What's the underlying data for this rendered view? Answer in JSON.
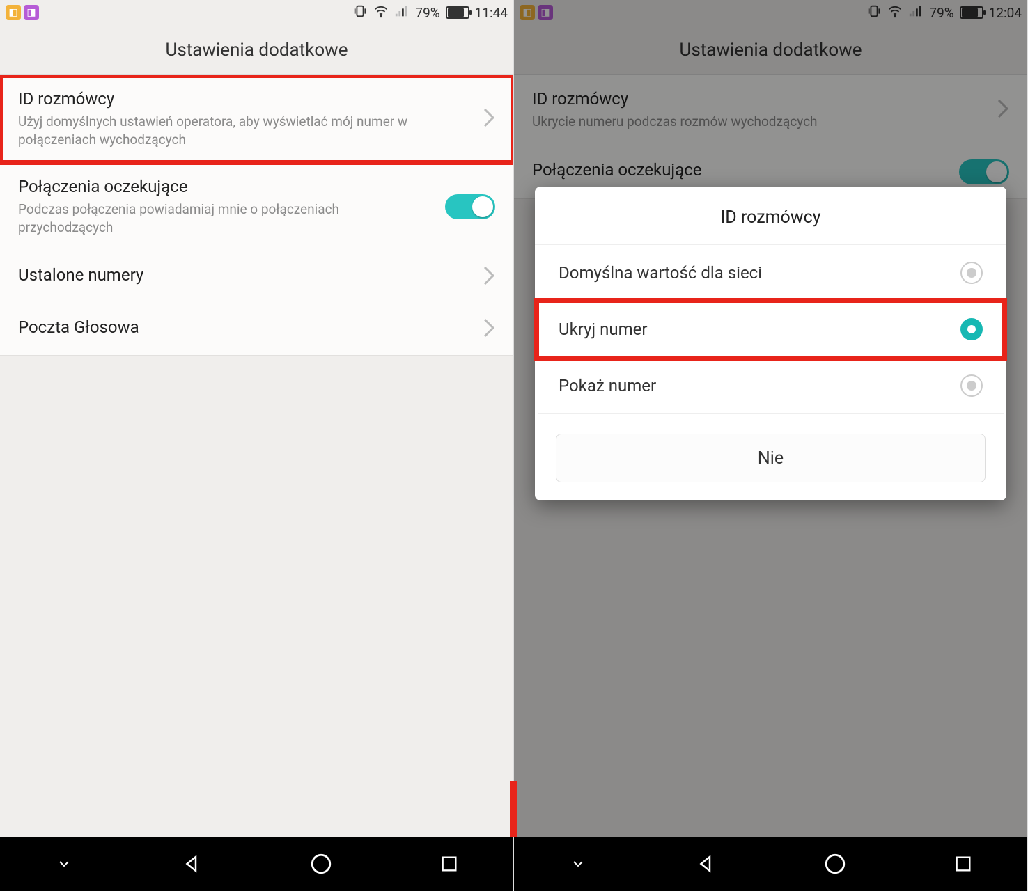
{
  "left": {
    "status": {
      "battery": "79%",
      "time": "11:44",
      "battery_fill": 79
    },
    "header": "Ustawienia dodatkowe",
    "rows": {
      "caller_id": {
        "title": "ID rozmówcy",
        "sub": "Użyj domyślnych ustawień operatora, aby wyświetlać mój numer w połączeniach wychodzących"
      },
      "call_waiting": {
        "title": "Połączenia oczekujące",
        "sub": "Podczas połączenia powiadamiaj mnie o połączeniach przychodzących"
      },
      "fixed_numbers": {
        "title": "Ustalone numery"
      },
      "voicemail": {
        "title": "Poczta Głosowa"
      }
    }
  },
  "right": {
    "status": {
      "battery": "79%",
      "time": "12:04",
      "battery_fill": 79
    },
    "header": "Ustawienia dodatkowe",
    "rows": {
      "caller_id": {
        "title": "ID rozmówcy",
        "sub": "Ukrycie numeru podczas rozmów wychodzących"
      },
      "call_waiting": {
        "title": "Połączenia oczekujące"
      }
    },
    "dialog": {
      "title": "ID rozmówcy",
      "options": {
        "default": "Domyślna wartość dla sieci",
        "hide": "Ukryj numer",
        "show": "Pokaż numer"
      },
      "cancel": "Nie"
    }
  }
}
